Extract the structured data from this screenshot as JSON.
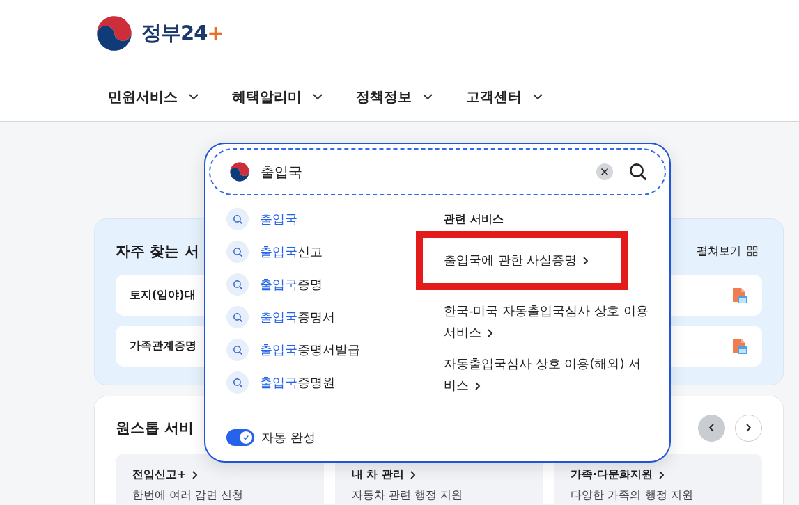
{
  "header": {
    "logo": {
      "name": "정부24",
      "mark": "+"
    }
  },
  "nav": [
    {
      "label": "민원서비스"
    },
    {
      "label": "혜택알리미"
    },
    {
      "label": "정책정보"
    },
    {
      "label": "고객센터"
    }
  ],
  "frequent": {
    "title": "자주 찾는 서",
    "expand": "펼쳐보기",
    "items": [
      {
        "label": "토지(임야)대"
      },
      {
        "label": "가족관계증명"
      }
    ]
  },
  "onestop": {
    "title": "원스톱 서비",
    "nav": [
      {
        "kind": "prev",
        "selected": true
      },
      {
        "kind": "next",
        "selected": false
      }
    ],
    "tiles": [
      {
        "title": "전입신고+",
        "desc": "한번에 여러 감면 신청"
      },
      {
        "title": "내 차 관리",
        "desc": "자동차 관련 행정 지원"
      },
      {
        "title": "가족·다문화지원",
        "desc": "다양한 가족의 행정 지원"
      }
    ]
  },
  "search": {
    "value": "출입국",
    "suggestions": [
      {
        "match": "출입국"
      },
      {
        "match": "출입국",
        "rest": "신고"
      },
      {
        "match": "출입국",
        "rest": "증명"
      },
      {
        "match": "출입국",
        "rest": "증명서"
      },
      {
        "match": "출입국",
        "rest": "증명서발급"
      },
      {
        "match": "출입국",
        "rest": "증명원"
      }
    ],
    "related": {
      "title": "관련 서비스",
      "items": [
        {
          "label": "출입국에 관한 사실증명",
          "highlighted": true
        },
        {
          "label": "한국-미국 자동출입국심사 상호 이용 서비스",
          "highlighted": false
        },
        {
          "label": "자동출입국심사 상호 이용(해외) 서비스",
          "highlighted": false
        }
      ]
    },
    "autocomplete": {
      "label": "자동 완성",
      "on": true
    }
  }
}
